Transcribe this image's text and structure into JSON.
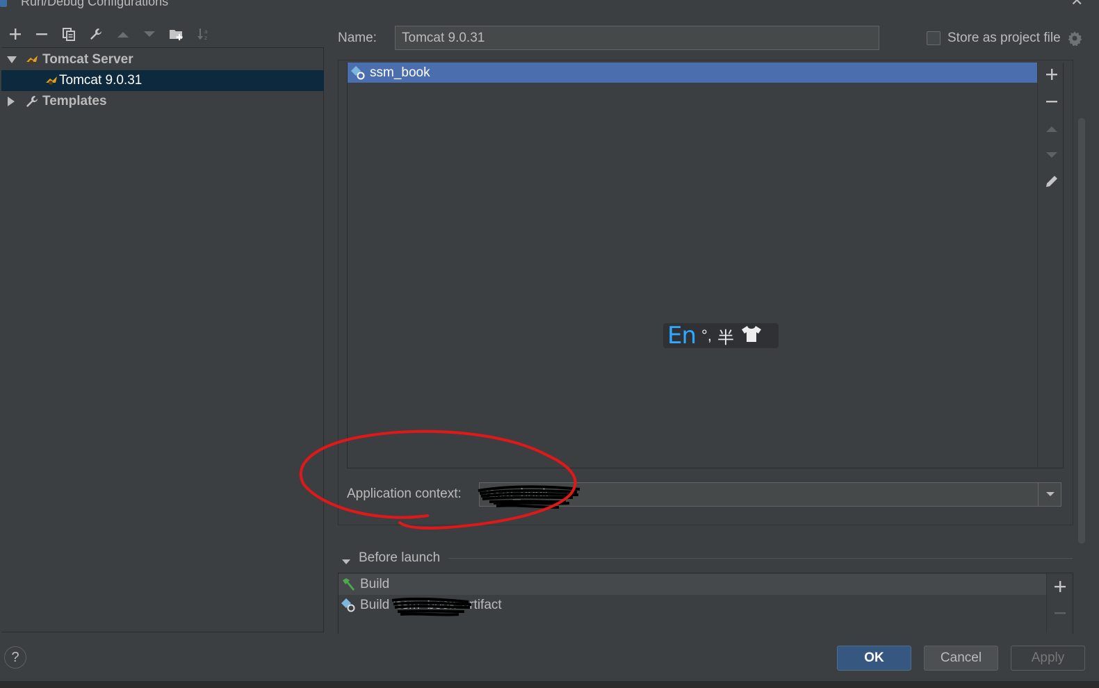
{
  "window": {
    "title": "Run/Debug Configurations"
  },
  "tree": {
    "items": [
      {
        "label": "Tomcat Server",
        "expanded": true,
        "icon": "tomcat-icon"
      },
      {
        "label": "Tomcat 9.0.31",
        "selected": true,
        "icon": "tomcat-icon"
      },
      {
        "label": "Templates",
        "expanded": false,
        "icon": "wrench-icon"
      }
    ]
  },
  "config": {
    "name_label": "Name:",
    "name_value": "Tomcat 9.0.31",
    "store_label": "Store as project file",
    "store_checked": false
  },
  "deployment": {
    "artifacts": [
      {
        "label": "ssm_book",
        "icon": "artifact-icon"
      }
    ],
    "app_context_label": "Application context:",
    "app_context_value": "/ssm_book"
  },
  "ime": {
    "lang": "En",
    "punct": "°,",
    "width": "半"
  },
  "before_launch": {
    "label": "Before launch",
    "tasks": [
      {
        "label": "Build",
        "icon": "hammer-icon"
      },
      {
        "label": "Build 'ssm_book' artifact",
        "icon": "artifact-icon"
      }
    ]
  },
  "footer": {
    "ok": "OK",
    "cancel": "Cancel",
    "apply": "Apply",
    "help": "?"
  },
  "colors": {
    "background": "#3c3f41",
    "selection": "#4b6eaf",
    "primary_button": "#365880",
    "annotation": "#e01818"
  }
}
